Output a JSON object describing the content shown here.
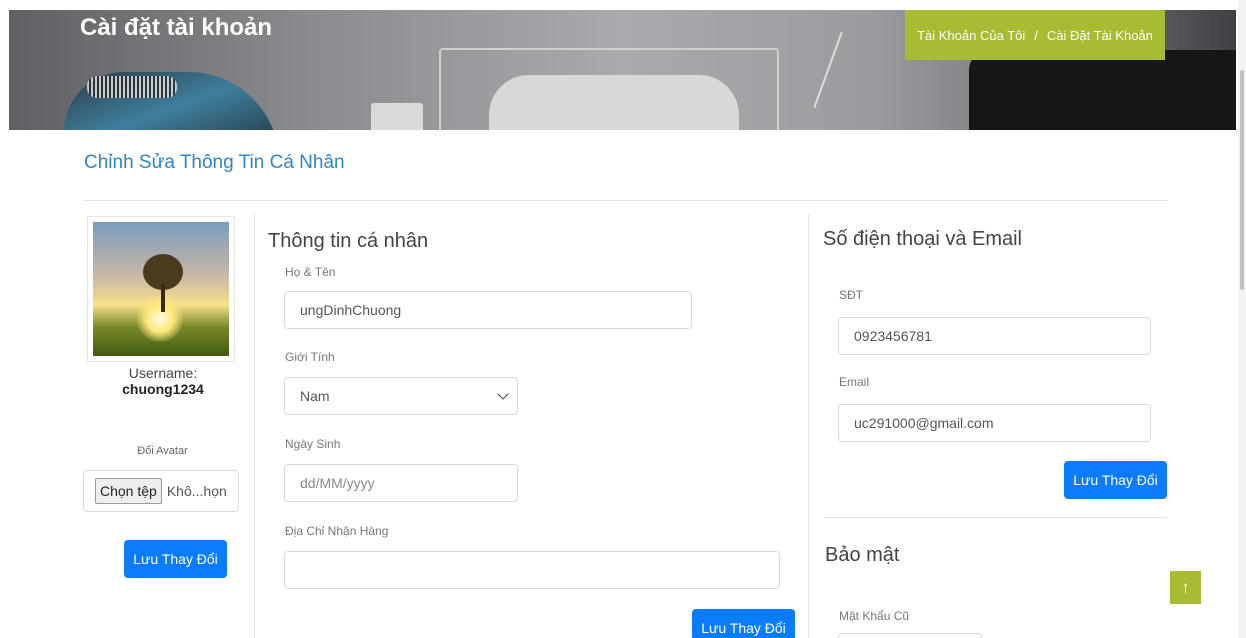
{
  "banner": {
    "title": "Cài đặt tài khoản"
  },
  "breadcrumb": {
    "items": [
      "Tài Khoản Của Tôi",
      "Cài Đặt Tài Khoản"
    ],
    "separator": "/"
  },
  "page": {
    "section_heading": "Chỉnh Sửa Thông Tin Cá Nhân"
  },
  "profile": {
    "username_label": "Username:",
    "username": "chuong1234",
    "avatar_label": "Đổi Avatar",
    "file_button": "Chọn tệp",
    "file_status": "Khô...họn",
    "save_label": "Lưu Thay Đổi"
  },
  "personal": {
    "title": "Thông tin cá nhân",
    "name_label": "Họ & Tên",
    "name_value": "ungDinhChuong",
    "gender_label": "Giới Tính",
    "gender_value": "Nam",
    "birthday_label": "Ngày Sinh",
    "birthday_placeholder": "dd/MM/yyyy",
    "address_label": "Địa Chỉ Nhận Hàng",
    "address_value": "",
    "save_label": "Lưu Thay Đổi"
  },
  "contact": {
    "title": "Số điện thoại và Email",
    "phone_label": "SĐT",
    "phone_value": "0923456781",
    "email_label": "Email",
    "email_value": "uc291000@gmail.com",
    "save_label": "Lưu Thay Đổi"
  },
  "security": {
    "title": "Bảo mật",
    "old_password_label": "Mật Khẩu Cũ"
  },
  "scroll_top": {
    "icon": "arrow-up-icon",
    "glyph": "↑"
  },
  "colors": {
    "accent": "#a9ba33",
    "primary": "#0a7cff",
    "heading_blue": "#2d85c7"
  }
}
